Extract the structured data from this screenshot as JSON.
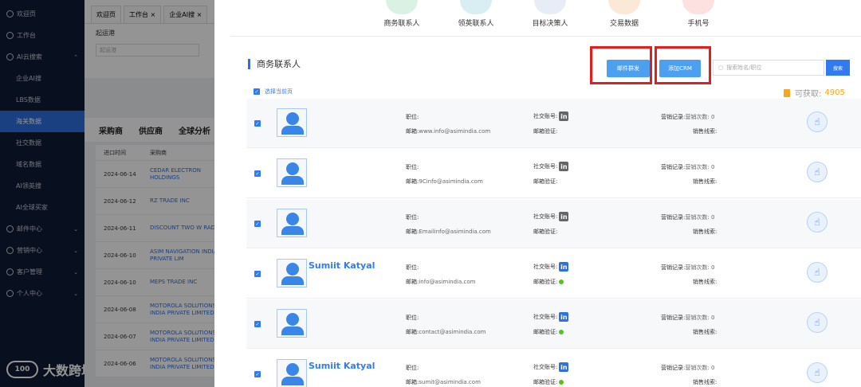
{
  "sidebar": {
    "items": [
      {
        "label": "欢迎页",
        "type": "top"
      },
      {
        "label": "工作台",
        "type": "top"
      },
      {
        "label": "AI云搜索",
        "type": "top",
        "expanded": true
      },
      {
        "label": "企业AI搜",
        "type": "sub"
      },
      {
        "label": "LBS数据",
        "type": "sub"
      },
      {
        "label": "海关数据",
        "type": "sub",
        "active": true
      },
      {
        "label": "社交数据",
        "type": "sub"
      },
      {
        "label": "域名数据",
        "type": "sub"
      },
      {
        "label": "AI领英搜",
        "type": "sub"
      },
      {
        "label": "AI全球买家",
        "type": "sub"
      },
      {
        "label": "邮件中心",
        "type": "top"
      },
      {
        "label": "营销中心",
        "type": "top"
      },
      {
        "label": "客户管理",
        "type": "top"
      },
      {
        "label": "个人中心",
        "type": "top"
      }
    ],
    "logo_text": "大数跨境"
  },
  "background_page": {
    "tabs": [
      "欢迎页",
      "工作台 ×",
      "企业AI搜 ×"
    ],
    "form_label": "起运港",
    "form_placeholder": "起运港",
    "section_tabs": [
      "采购商",
      "供应商",
      "全球分析"
    ],
    "table_headers": [
      "进口时间",
      "采购商"
    ],
    "rows": [
      {
        "date": "2024-06-14",
        "buyer": "CEDAR ELECTRON HOLDINGS"
      },
      {
        "date": "2024-06-12",
        "buyer": "RZ TRADE INC"
      },
      {
        "date": "2024-06-11",
        "buyer": "DISCOUNT TWO W RADIO"
      },
      {
        "date": "2024-06-10",
        "buyer": "ASIM NAVIGATION INDIA PRIVATE LIM"
      },
      {
        "date": "2024-06-10",
        "buyer": "MEPS TRADE INC"
      },
      {
        "date": "2024-06-08",
        "buyer": "MOTOROLA SOLUTIONS INDIA PRIVATE LIMITED"
      },
      {
        "date": "2024-06-07",
        "buyer": "MOTOROLA SOLUTIONS INDIA PRIVATE LIMITED"
      },
      {
        "date": "2024-06-06",
        "buyer": "MOTOROLA SOLUTIONS INDIA PRIVATE LIMITED"
      }
    ]
  },
  "drawer": {
    "top_categories": [
      "商务联系人",
      "领英联系人",
      "目标决策人",
      "交易数据",
      "手机号"
    ],
    "section_title": "商务联系人",
    "email_button": "邮件群发",
    "crm_button": "添加CRM",
    "search_placeholder": "搜索姓名/职位",
    "search_button": "搜索",
    "select_page": "选择当前页",
    "available_label": "可获取:",
    "available_count": "4905",
    "labels": {
      "title": "职位:",
      "email": "邮箱:",
      "social": "社交账号:",
      "verify": "邮箱验证:",
      "marketing": "营销记录:",
      "marketing_count": "营销次数: 0",
      "leads": "销售线索:"
    },
    "contacts": [
      {
        "name": "",
        "email": "www.info@asimindia.com",
        "verified": false,
        "li_active": false
      },
      {
        "name": "",
        "email": "9Cinfo@asimindia.com",
        "verified": false,
        "li_active": false
      },
      {
        "name": "",
        "email": "Emailinfo@asimindia.com",
        "verified": false,
        "li_active": false
      },
      {
        "name": "Sumiit Katyal",
        "email": "info@asimindia.com",
        "verified": true,
        "li_active": true
      },
      {
        "name": "",
        "email": "contact@asimindia.com",
        "verified": true,
        "li_active": true
      },
      {
        "name": "Sumiit Katyal",
        "email": "sumit@asimindia.com",
        "verified": true,
        "li_active": true
      }
    ]
  },
  "colors": {
    "accent": "#2f7cf0",
    "highlight": "#e01f1f",
    "sidebar_bg": "#0e1a35",
    "available": "#f5a623"
  }
}
